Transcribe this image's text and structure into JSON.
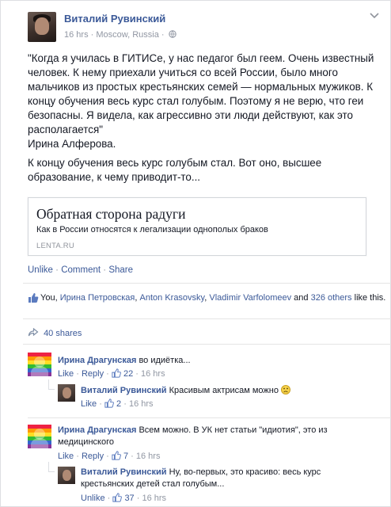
{
  "post": {
    "author": "Виталий Рувинский",
    "meta": "16 hrs · Moscow, Russia ·",
    "privacy_icon": "globe-icon",
    "text_lines": [
      "\"Когда я училась в ГИТИСе, у нас педагог был геем. Очень известный",
      "человек. К нему приехали учиться со всей России, было много",
      "мальчиков из простых крестьянских семей — нормальных мужиков. К",
      "концу обучения весь курс стал голубым. Поэтому я не верю, что геи",
      "безопасны. Я видела, как агрессивно эти люди действуют, как это",
      "располагается\""
    ],
    "signature": "Ирина Алферова.",
    "comment_lines": [
      "К концу обучения весь курс голубым стал. Вот оно, высшее",
      "образование, к чему приводит-то..."
    ],
    "link": {
      "title": "Обратная сторона радуги",
      "description": "Как в России относятся к легализации однополых браков",
      "domain": "LENTA.RU"
    },
    "actions": {
      "unlike": "Unlike",
      "comment": "Comment",
      "share": "Share",
      "separator": "·"
    },
    "likes": {
      "prefix": "You, ",
      "names": [
        "Ирина Петровская",
        "Anton Krasovsky",
        "Vladimir Varfolomeev"
      ],
      "and": " and ",
      "others": "326 others",
      "suffix": " like this."
    },
    "shares": "40 shares"
  },
  "comments": [
    {
      "author": "Ирина Драгунская",
      "text": "во идиётка...",
      "like_label": "Like",
      "reply_label": "Reply",
      "likes": "22",
      "time": "16 hrs"
    },
    {
      "author": "Виталий Рувинский",
      "text": "Красивым актрисам можно",
      "emoji": "frowning-face-icon",
      "like_label": "Like",
      "likes": "2",
      "time": "16 hrs"
    },
    {
      "author": "Ирина Драгунская",
      "text_lines": [
        "Всем можно. В УК нет статьи \"идиотия\", это из",
        "медицинского"
      ],
      "like_label": "Like",
      "reply_label": "Reply",
      "likes": "7",
      "time": "16 hrs"
    },
    {
      "author": "Виталий Рувинский",
      "text_lines": [
        "Ну, во-первых, это красиво: весь курс",
        "крестьянских детей стал голубым..."
      ],
      "like_label": "Unlike",
      "likes": "37",
      "time": "16 hrs"
    }
  ],
  "colors": {
    "link": "#3b5998",
    "meta": "#9197a3",
    "text": "#141823"
  }
}
